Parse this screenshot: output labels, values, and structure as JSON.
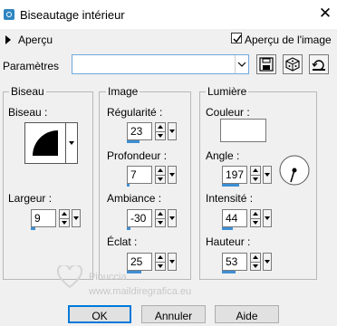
{
  "window": {
    "title": "Biseautage intérieur",
    "close_glyph": "✕"
  },
  "preview": {
    "expand_label": "Aperçu",
    "show_preview_label": "Aperçu de l'image",
    "show_preview_checked": true
  },
  "params": {
    "label": "Paramètres",
    "value": ""
  },
  "toolbar": {
    "icons": [
      "save-icon",
      "dice-icon",
      "reset-icon"
    ]
  },
  "groups": {
    "biseau": {
      "title": "Biseau",
      "shape_label": "Biseau :",
      "width_label": "Largeur :",
      "width_value": "9"
    },
    "image": {
      "title": "Image",
      "smoothness_label": "Régularité :",
      "smoothness_value": "23",
      "depth_label": "Profondeur :",
      "depth_value": "7",
      "ambience_label": "Ambiance :",
      "ambience_value": "-30",
      "shine_label": "Éclat :",
      "shine_value": "25"
    },
    "light": {
      "title": "Lumière",
      "color_label": "Couleur :",
      "color_value": "#ffffff",
      "angle_label": "Angle :",
      "angle_value": "197",
      "intensity_label": "Intensité :",
      "intensity_value": "44",
      "height_label": "Hauteur :",
      "height_value": "53"
    }
  },
  "buttons": {
    "ok": "OK",
    "cancel": "Annuler",
    "help": "Aide"
  },
  "watermark": {
    "line1": "Pinuccia",
    "line2": "www.maildiregrafica.eu"
  },
  "colors": {
    "accent": "#3f8fd4",
    "focus": "#0078d7"
  }
}
